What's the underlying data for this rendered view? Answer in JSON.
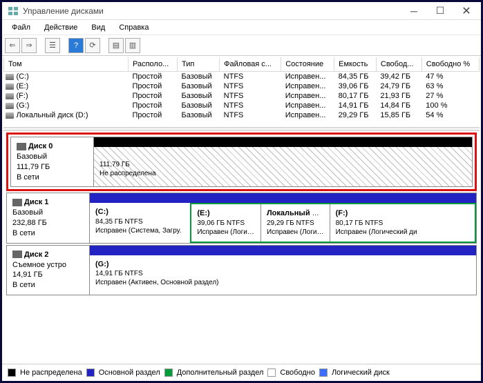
{
  "title": "Управление дисками",
  "menu": {
    "file": "Файл",
    "action": "Действие",
    "view": "Вид",
    "help": "Справка"
  },
  "columns": {
    "vol": "Том",
    "layout": "Располо...",
    "type": "Тип",
    "fs": "Файловая с...",
    "status": "Состояние",
    "cap": "Емкость",
    "free": "Свобод...",
    "pct": "Свободно %"
  },
  "volumes": [
    {
      "name": "(C:)",
      "layout": "Простой",
      "type": "Базовый",
      "fs": "NTFS",
      "status": "Исправен...",
      "cap": "84,35 ГБ",
      "free": "39,42 ГБ",
      "pct": "47 %"
    },
    {
      "name": "(E:)",
      "layout": "Простой",
      "type": "Базовый",
      "fs": "NTFS",
      "status": "Исправен...",
      "cap": "39,06 ГБ",
      "free": "24,79 ГБ",
      "pct": "63 %"
    },
    {
      "name": "(F:)",
      "layout": "Простой",
      "type": "Базовый",
      "fs": "NTFS",
      "status": "Исправен...",
      "cap": "80,17 ГБ",
      "free": "21,93 ГБ",
      "pct": "27 %"
    },
    {
      "name": "(G:)",
      "layout": "Простой",
      "type": "Базовый",
      "fs": "NTFS",
      "status": "Исправен...",
      "cap": "14,91 ГБ",
      "free": "14,84 ГБ",
      "pct": "100 %"
    },
    {
      "name": "Локальный диск (D:)",
      "layout": "Простой",
      "type": "Базовый",
      "fs": "NTFS",
      "status": "Исправен...",
      "cap": "29,29 ГБ",
      "free": "15,85 ГБ",
      "pct": "54 %"
    }
  ],
  "disk0": {
    "title": "Диск 0",
    "type": "Базовый",
    "size": "111,79 ГБ",
    "online": "В сети",
    "unalloc_size": "111,79 ГБ",
    "unalloc_label": "Не распределена"
  },
  "disk1": {
    "title": "Диск 1",
    "type": "Базовый",
    "size": "232,88 ГБ",
    "online": "В сети",
    "parts": [
      {
        "label": "(C:)",
        "info": "84,35 ГБ NTFS",
        "status": "Исправен (Система, Загру."
      },
      {
        "label": "(E:)",
        "info": "39,06 ГБ NTFS",
        "status": "Исправен (Логический ,"
      },
      {
        "label": "Локальный диск  (D:)",
        "info": "29,29 ГБ NTFS",
        "status": "Исправен (Логический ,"
      },
      {
        "label": "(F:)",
        "info": "80,17 ГБ NTFS",
        "status": "Исправен (Логический ди"
      }
    ]
  },
  "disk2": {
    "title": "Диск 2",
    "type": "Съемное устро",
    "size": "14,91 ГБ",
    "online": "В сети",
    "part": {
      "label": "(G:)",
      "info": "14,91 ГБ NTFS",
      "status": "Исправен (Активен, Основной раздел)"
    }
  },
  "legend": {
    "unalloc": "Не распределена",
    "primary": "Основной раздел",
    "ext": "Дополнительный раздел",
    "free": "Свободно",
    "logical": "Логический диск"
  }
}
